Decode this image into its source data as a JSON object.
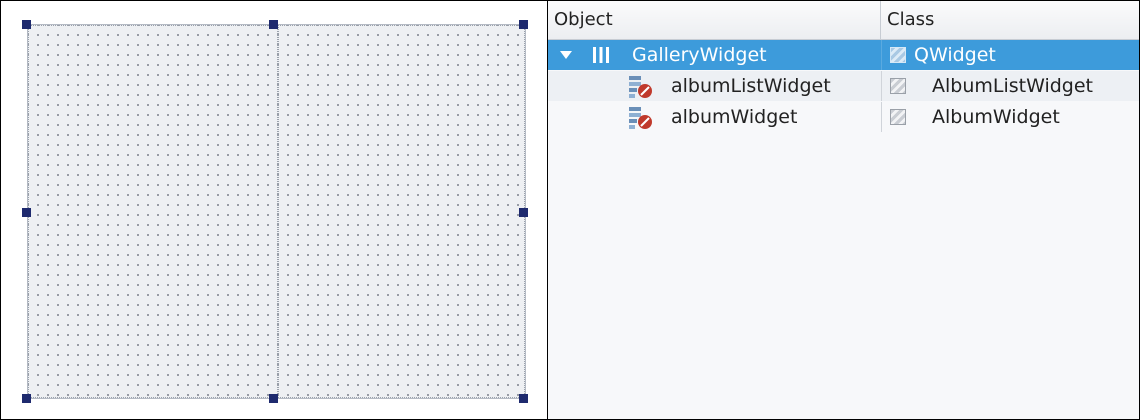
{
  "inspector": {
    "columns": {
      "object": "Object",
      "class": "Class"
    },
    "rows": [
      {
        "object": "GalleryWidget",
        "class": "QWidget",
        "expanded": true,
        "selected": true,
        "icon": "horizontal-layout-icon"
      },
      {
        "object": "albumListWidget",
        "class": "AlbumListWidget",
        "selected": false,
        "icon": "widget-broken-icon"
      },
      {
        "object": "albumWidget",
        "class": "AlbumWidget",
        "selected": false,
        "icon": "widget-broken-icon"
      }
    ]
  },
  "colors": {
    "selection": "#3d9bdb",
    "handle": "#1e2a6e",
    "form_background": "#eef0f3"
  }
}
